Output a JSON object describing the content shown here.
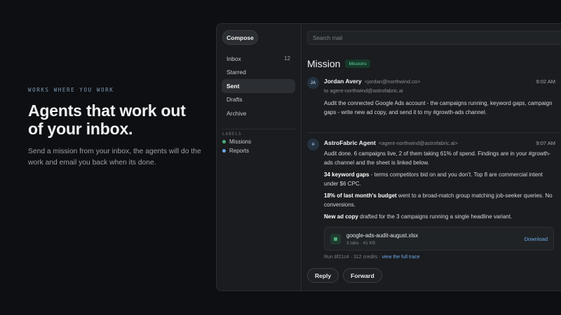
{
  "hero": {
    "eyebrow": "WORKS WHERE YOU WORK",
    "headline": "Agents that work out of your inbox.",
    "lede": "Send a mission from your inbox, the agents will do the work and email you back when its done."
  },
  "sidebar": {
    "compose_label": "Compose",
    "items": [
      {
        "label": "Inbox",
        "count": "12"
      },
      {
        "label": "Starred",
        "count": ""
      },
      {
        "label": "Sent",
        "count": ""
      },
      {
        "label": "Drafts",
        "count": ""
      },
      {
        "label": "Archive",
        "count": ""
      }
    ],
    "active_item": "Sent",
    "labels_heading": "LABELS",
    "labels": [
      {
        "label": "Missions",
        "color": "#4fae7f"
      },
      {
        "label": "Reports",
        "color": "#6ea8e6"
      }
    ]
  },
  "search": {
    "placeholder": "Search mail"
  },
  "thread": {
    "title": "Mission",
    "badge": "Missions",
    "messages": [
      {
        "avatar": "JA",
        "sender": "Jordan Avery",
        "email": "<jordan@northwind.co>",
        "time": "9:02 AM",
        "to": "to agent-northwind@astrofabric.ai",
        "body": "Audit the connected Google Ads account - the campaigns running, keyword gaps, campaign gaps - write new ad copy, and send it to my #growth-ads channel."
      },
      {
        "avatar": "✲",
        "sender": "AstroFabric Agent",
        "email": "<agent-northwind@astrofabric.ai>",
        "time": "9:07 AM",
        "intro": "Audit done. 6 campaigns live, 2 of them taking 61% of spend. Findings are in your #growth-ads channel and the sheet is linked below.",
        "findings": [
          {
            "bold": "34 keyword gaps",
            "rest": " - terms competitors bid on and you don't. Top 8 are commercial intent under $6 CPC."
          },
          {
            "bold": "18% of last month's budget",
            "rest": " went to a broad-match group matching job-seeker queries. No conversions."
          },
          {
            "bold": "New ad copy",
            "rest": " drafted for the 3 campaigns running a single headline variant."
          }
        ],
        "attachment": {
          "name": "google-ads-audit-august.xlsx",
          "meta": "3 tabs · 41 KB",
          "action": "Download"
        },
        "run_text": "Run 8f21c4 · 312 credits · ",
        "trace_link": "view the full trace"
      }
    ]
  },
  "actions": {
    "reply": "Reply",
    "forward": "Forward"
  }
}
